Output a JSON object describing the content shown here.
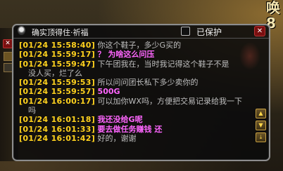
{
  "window": {
    "title": "确实顶得住·祈福",
    "protect_label": "已保护",
    "close_glyph": "✕",
    "corner_text": "唤\n8"
  },
  "chat": {
    "lines": [
      {
        "ts": "[01/24 15:58:40]",
        "text": "你这个鞋子，多少G买的",
        "dir": "in"
      },
      {
        "ts": "[01/24 15:59:17]",
        "text": "？ 为啥这么问压",
        "dir": "out"
      },
      {
        "ts": "[01/24 15:59:47]",
        "text": "下午团我在，当时我记得这个鞋子不是",
        "cont": "没人买，烂了么",
        "dir": "in"
      },
      {
        "ts": "[01/24 15:59:53]",
        "text": "所以问问团长私下多少卖你的",
        "dir": "in"
      },
      {
        "ts": "[01/24 15:59:57]",
        "text": "500G",
        "dir": "out"
      },
      {
        "ts": "[01/24 16:00:17]",
        "text": "可以加你WX吗，方便把交易记录给我一下",
        "cont": "吗",
        "dir": "in"
      },
      {
        "ts": "[01/24 16:01:18]",
        "text": "我还没给G呢",
        "dir": "out"
      },
      {
        "ts": "[01/24 16:01:33]",
        "text": "要去做任务赚钱 还",
        "dir": "out"
      },
      {
        "ts": "[01/24 16:01:42]",
        "text": "好的，谢谢",
        "dir": "in"
      }
    ]
  },
  "colors": {
    "timestamp": "#ffd21e",
    "incoming": "#bfbfbf",
    "outgoing": "#ff66ff"
  }
}
